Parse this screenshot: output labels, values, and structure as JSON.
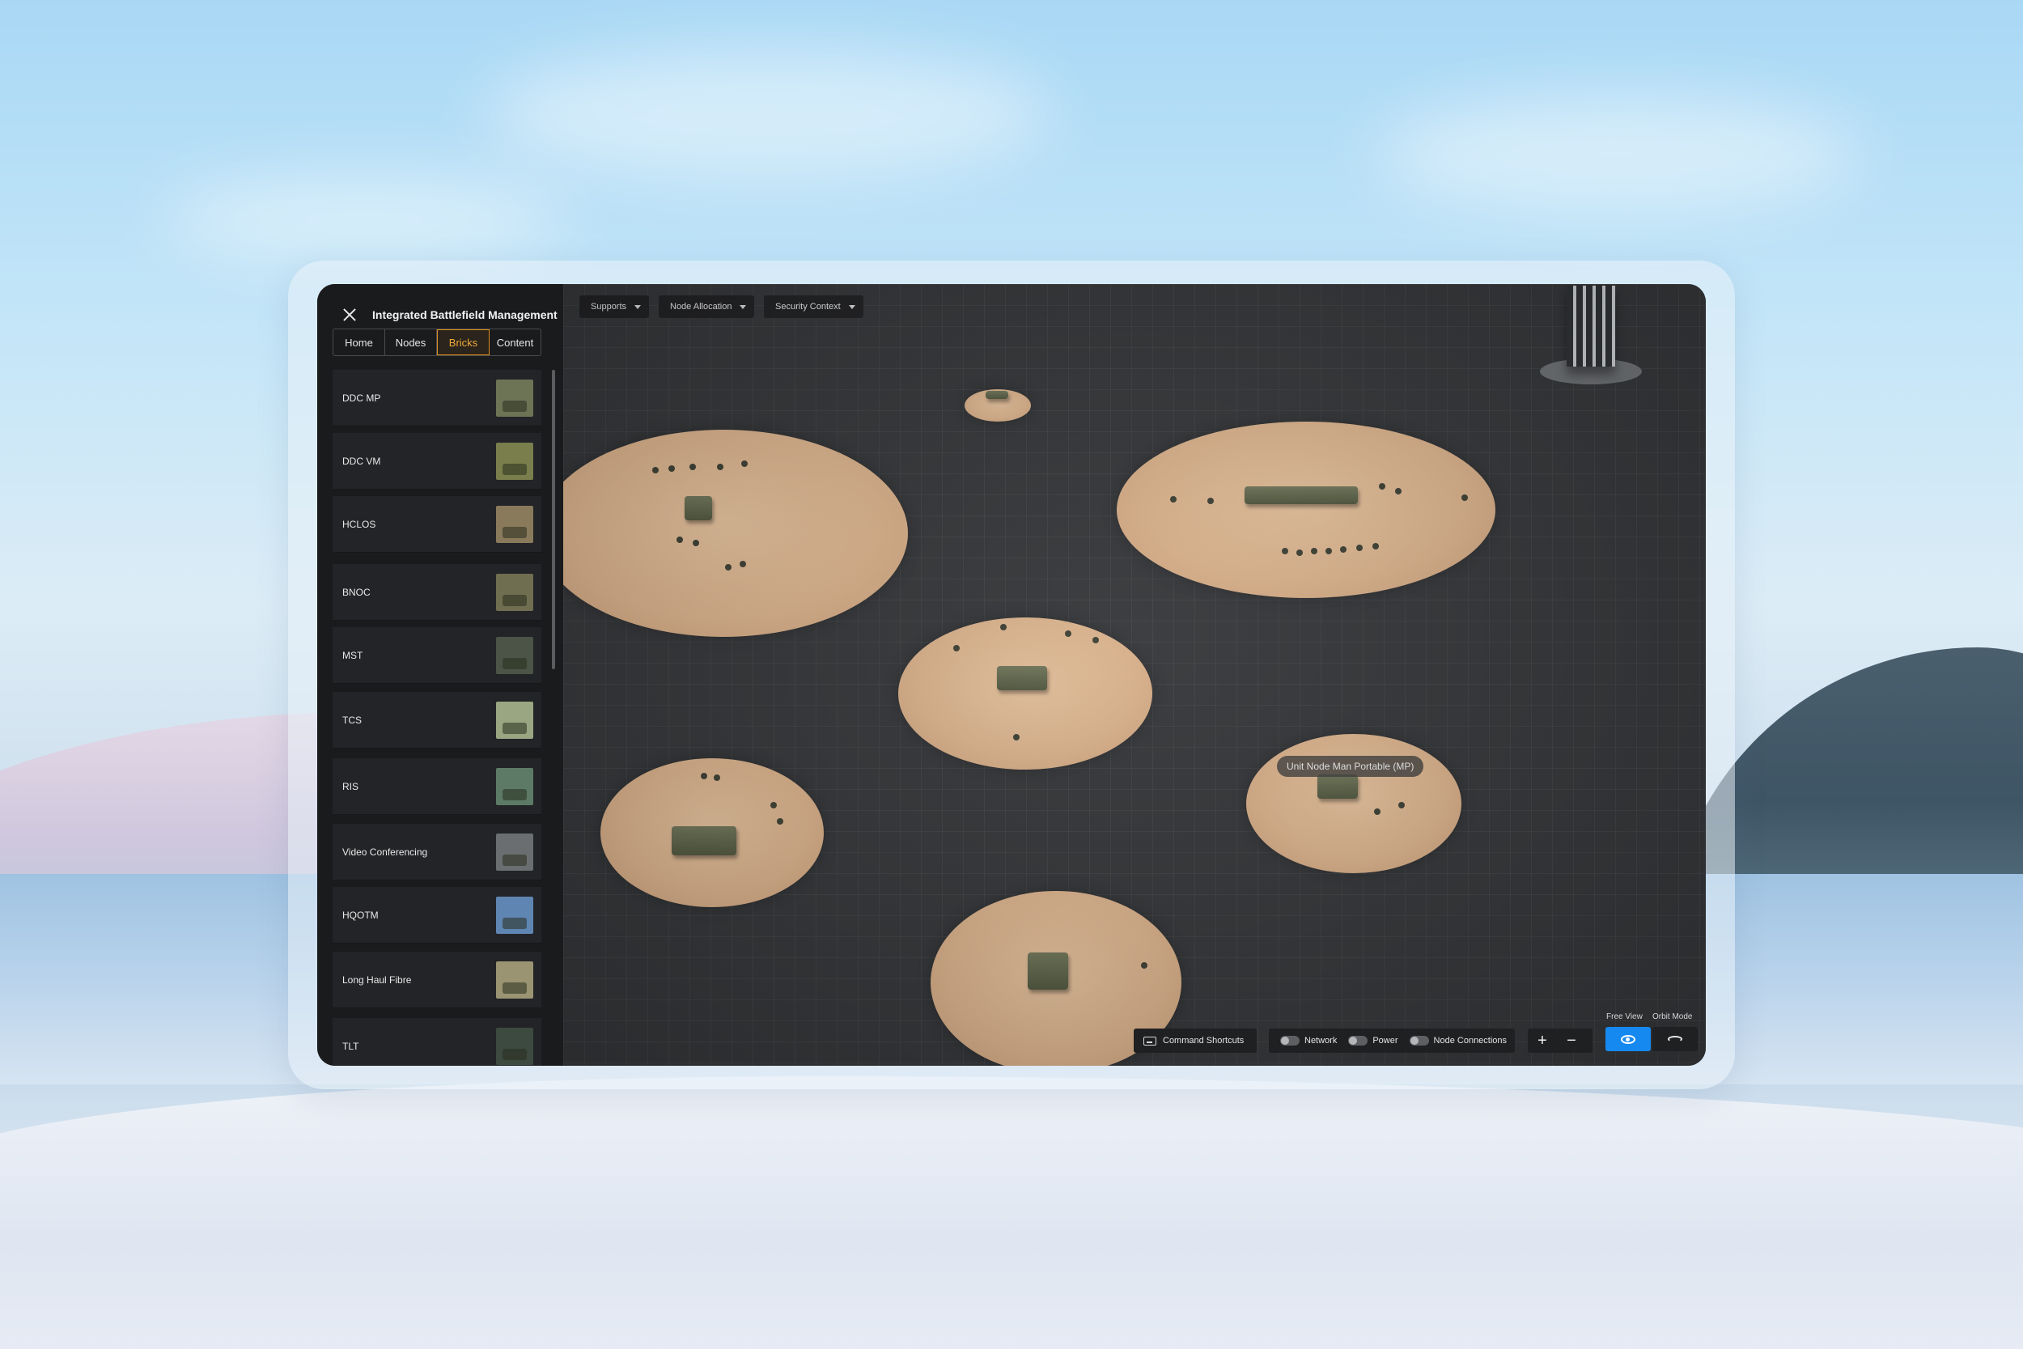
{
  "app": {
    "title": "Integrated Battlefield Management"
  },
  "tabs": [
    {
      "label": "Home"
    },
    {
      "label": "Nodes"
    },
    {
      "label": "Bricks",
      "active": true
    },
    {
      "label": "Content"
    }
  ],
  "bricks": [
    {
      "label": "DDC MP",
      "thumb": "#6d7456"
    },
    {
      "label": "DDC VM",
      "thumb": "#7a7e4c"
    },
    {
      "label": "HCLOS",
      "thumb": "#8a7a5c"
    },
    {
      "label": "BNOC",
      "thumb": "#6f6e50"
    },
    {
      "label": "MST",
      "thumb": "#4b5446"
    },
    {
      "label": "TCS",
      "thumb": "#9aa682"
    },
    {
      "label": "RIS",
      "thumb": "#5d7a66"
    },
    {
      "label": "Video Conferencing",
      "thumb": "#6a6e70"
    },
    {
      "label": "HQOTM",
      "thumb": "#5f86b2"
    },
    {
      "label": "Long Haul Fibre",
      "thumb": "#9a9472"
    },
    {
      "label": "TLT",
      "thumb": "#3c4a40"
    }
  ],
  "filters": {
    "supports": "Supports",
    "node_allocation": "Node Allocation",
    "security_context": "Security Context"
  },
  "scene": {
    "tooltip": "Unit Node Man Portable (MP)"
  },
  "toolbar": {
    "command_shortcuts": "Command Shortcuts",
    "toggles": {
      "network": "Network",
      "power": "Power",
      "node_connections": "Node Connections"
    },
    "zoom_in": "+",
    "zoom_out": "−",
    "free_view": "Free View",
    "orbit_mode": "Orbit Mode"
  },
  "colors": {
    "accent": "#f0a83a",
    "active_view": "#1589f0",
    "sidebar_bg": "#1a1b1d",
    "disc": "#d8b08a"
  }
}
